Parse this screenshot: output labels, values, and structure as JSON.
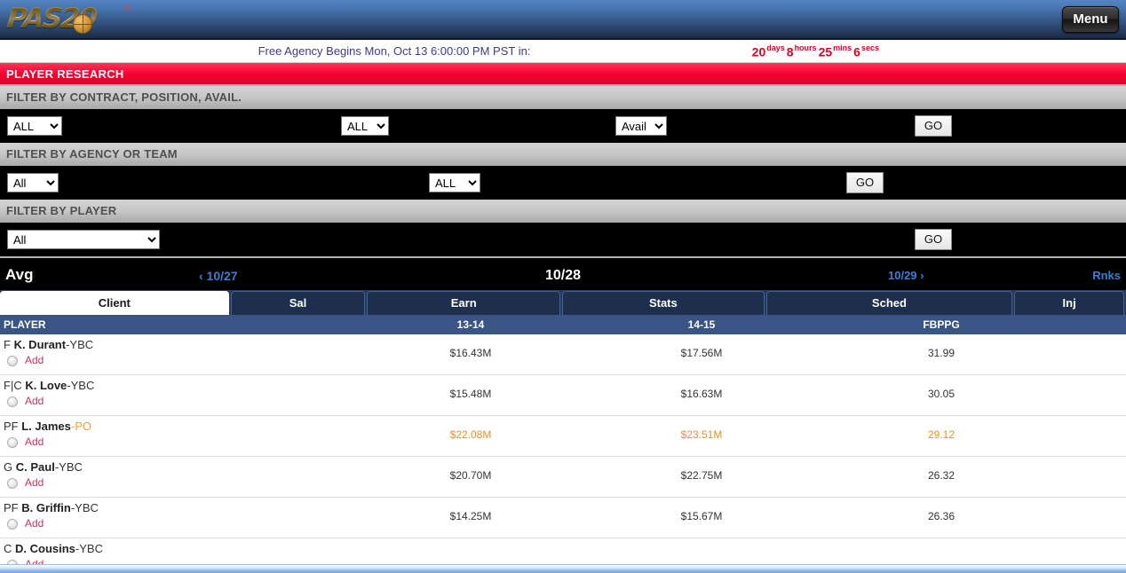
{
  "header": {
    "logo_text": "PAS20",
    "logo_registered": "®",
    "menu_label": "Menu"
  },
  "countdown": {
    "label": "Free Agency Begins Mon, Oct 13 6:00:00 PM PST in:",
    "days": "20",
    "days_unit": "days",
    "hours": "8",
    "hours_unit": "hours",
    "mins": "25",
    "mins_unit": "mins",
    "secs": "6",
    "secs_unit": "secs",
    "color": "#e00024"
  },
  "sections": {
    "player_research": "PLAYER RESEARCH",
    "filter_contract": "FILTER BY CONTRACT, POSITION, AVAIL.",
    "filter_agency": "FILTER BY AGENCY OR TEAM",
    "filter_player": "FILTER BY PLAYER"
  },
  "filters": {
    "contract_value": "ALL",
    "position_value": "ALL",
    "avail_value": "Avail",
    "go1": "GO",
    "agency_value": "All",
    "team_value": "ALL",
    "go2": "GO",
    "player_value": "All",
    "go3": "GO"
  },
  "datebar": {
    "avg": "Avg",
    "prev": "‹ 10/27",
    "current": "10/28",
    "next": "10/29 ›",
    "rnks": "Rnks"
  },
  "tabs": [
    {
      "label": "Client",
      "active": true
    },
    {
      "label": "Sal",
      "active": false
    },
    {
      "label": "Earn",
      "active": false
    },
    {
      "label": "Stats",
      "active": false
    },
    {
      "label": "Sched",
      "active": false
    },
    {
      "label": "Inj",
      "active": false
    }
  ],
  "table": {
    "columns": [
      "PLAYER",
      "13-14",
      "14-15",
      "FBPPG"
    ],
    "add_label": "Add",
    "rows": [
      {
        "pos": "F",
        "name": "K. Durant",
        "suffix": "-YBC",
        "suffix_type": "ybc",
        "sal_13_14": "$16.43M",
        "sal_14_15": "$17.56M",
        "fbppg": "31.99",
        "highlight": false
      },
      {
        "pos": "F|C",
        "name": "K. Love",
        "suffix": "-YBC",
        "suffix_type": "ybc",
        "sal_13_14": "$15.48M",
        "sal_14_15": "$16.63M",
        "fbppg": "30.05",
        "highlight": false
      },
      {
        "pos": "PF",
        "name": "L. James",
        "suffix": "-PO",
        "suffix_type": "po",
        "sal_13_14": "$22.08M",
        "sal_14_15": "$23.51M",
        "fbppg": "29.12",
        "highlight": true
      },
      {
        "pos": "G",
        "name": "C. Paul",
        "suffix": "-YBC",
        "suffix_type": "ybc",
        "sal_13_14": "$20.70M",
        "sal_14_15": "$22.75M",
        "fbppg": "26.32",
        "highlight": false
      },
      {
        "pos": "PF",
        "name": "B. Griffin",
        "suffix": "-YBC",
        "suffix_type": "ybc",
        "sal_13_14": "$14.25M",
        "sal_14_15": "$15.67M",
        "fbppg": "26.36",
        "highlight": false
      },
      {
        "pos": "C",
        "name": "D. Cousins",
        "suffix": "-YBC",
        "suffix_type": "ybc",
        "sal_13_14": "",
        "sal_14_15": "",
        "fbppg": "",
        "highlight": false
      }
    ]
  }
}
